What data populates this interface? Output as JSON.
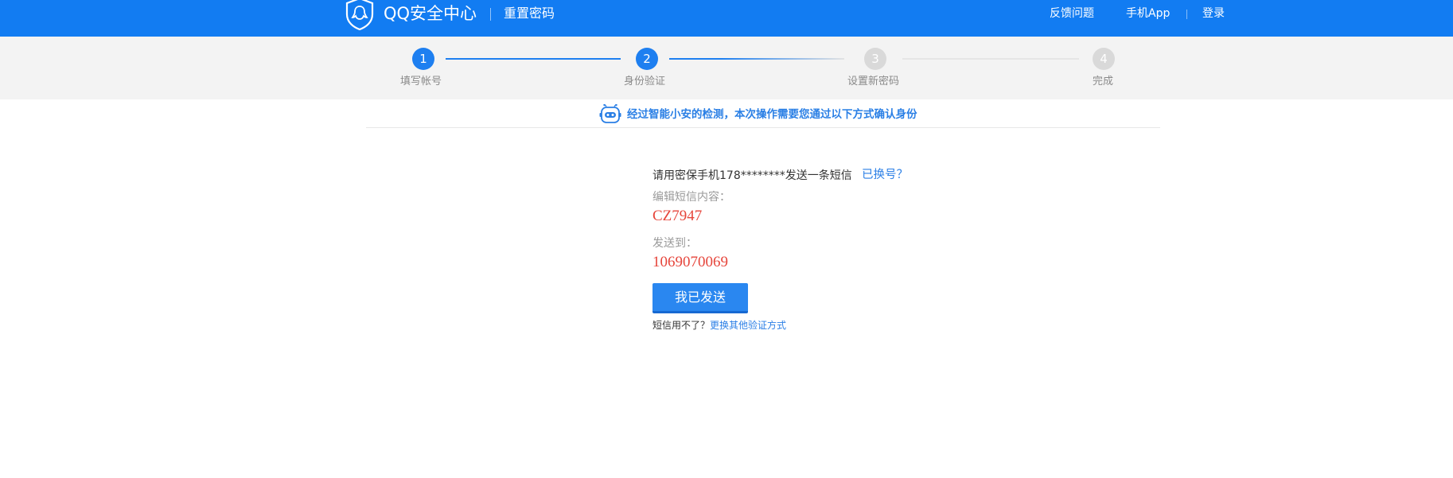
{
  "header": {
    "brand": "QQ安全中心",
    "page_title": "重置密码",
    "nav": {
      "feedback": "反馈问题",
      "mobile_app": "手机App",
      "login": "登录"
    },
    "colors": {
      "bar": "#127cf2"
    }
  },
  "stepper": {
    "steps": [
      {
        "number": "1",
        "label": "填写帐号",
        "state": "done"
      },
      {
        "number": "2",
        "label": "身份验证",
        "state": "current"
      },
      {
        "number": "3",
        "label": "设置新密码",
        "state": "pending"
      },
      {
        "number": "4",
        "label": "完成",
        "state": "pending"
      }
    ],
    "colors": {
      "active": "#1e7ff0",
      "inactive": "#d9d9d9"
    }
  },
  "notice": {
    "icon": "robot-icon",
    "text": "经过智能小安的检测，本次操作需要您通过以下方式确认身份"
  },
  "main": {
    "instruction": "请用密保手机178********发送一条短信",
    "change_number": "已换号？",
    "sms_content_label": "编辑短信内容：",
    "sms_content_value": "CZ7947",
    "send_to_label": "发送到：",
    "send_to_value": "1069070069",
    "sent_button": "我已发送",
    "footer_question": "短信用不了？",
    "footer_link": "更换其他验证方式"
  }
}
